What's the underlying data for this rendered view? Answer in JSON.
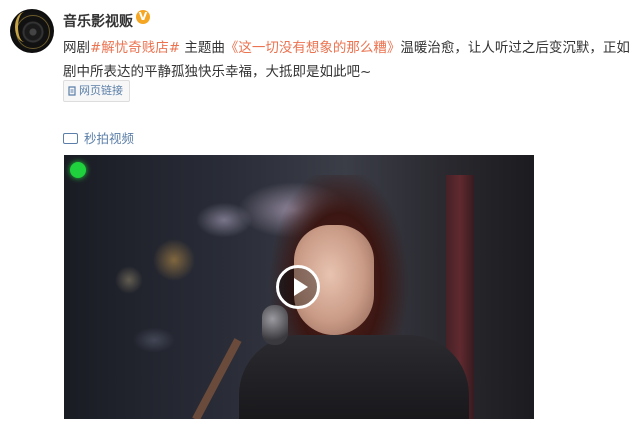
{
  "post": {
    "username": "音乐影视贩",
    "verified_badge": "V",
    "text_prefix": "网剧",
    "hashtag": "#解忧奇贱店#",
    "text_mid": " 主题曲",
    "song_link": "《这一切没有想象的那么糟》",
    "text_rest": "温暖治愈，让人听过之后变沉默，正如剧中所表达的平静孤独快乐幸福，大抵即是如此吧~",
    "link_chip_label": "网页链接",
    "section_label": "秒拍视频"
  },
  "colors": {
    "accent_link": "#eb7350",
    "blue_text": "#5b7fa8",
    "verified": "#f5a623",
    "indicator_green": "#1fd13c"
  },
  "icons": {
    "avatar": "vinyl-disc-avatar",
    "verified": "verified-badge-icon",
    "link": "link-icon",
    "video": "video-camera-icon",
    "play": "play-icon",
    "live": "green-indicator-dot"
  }
}
